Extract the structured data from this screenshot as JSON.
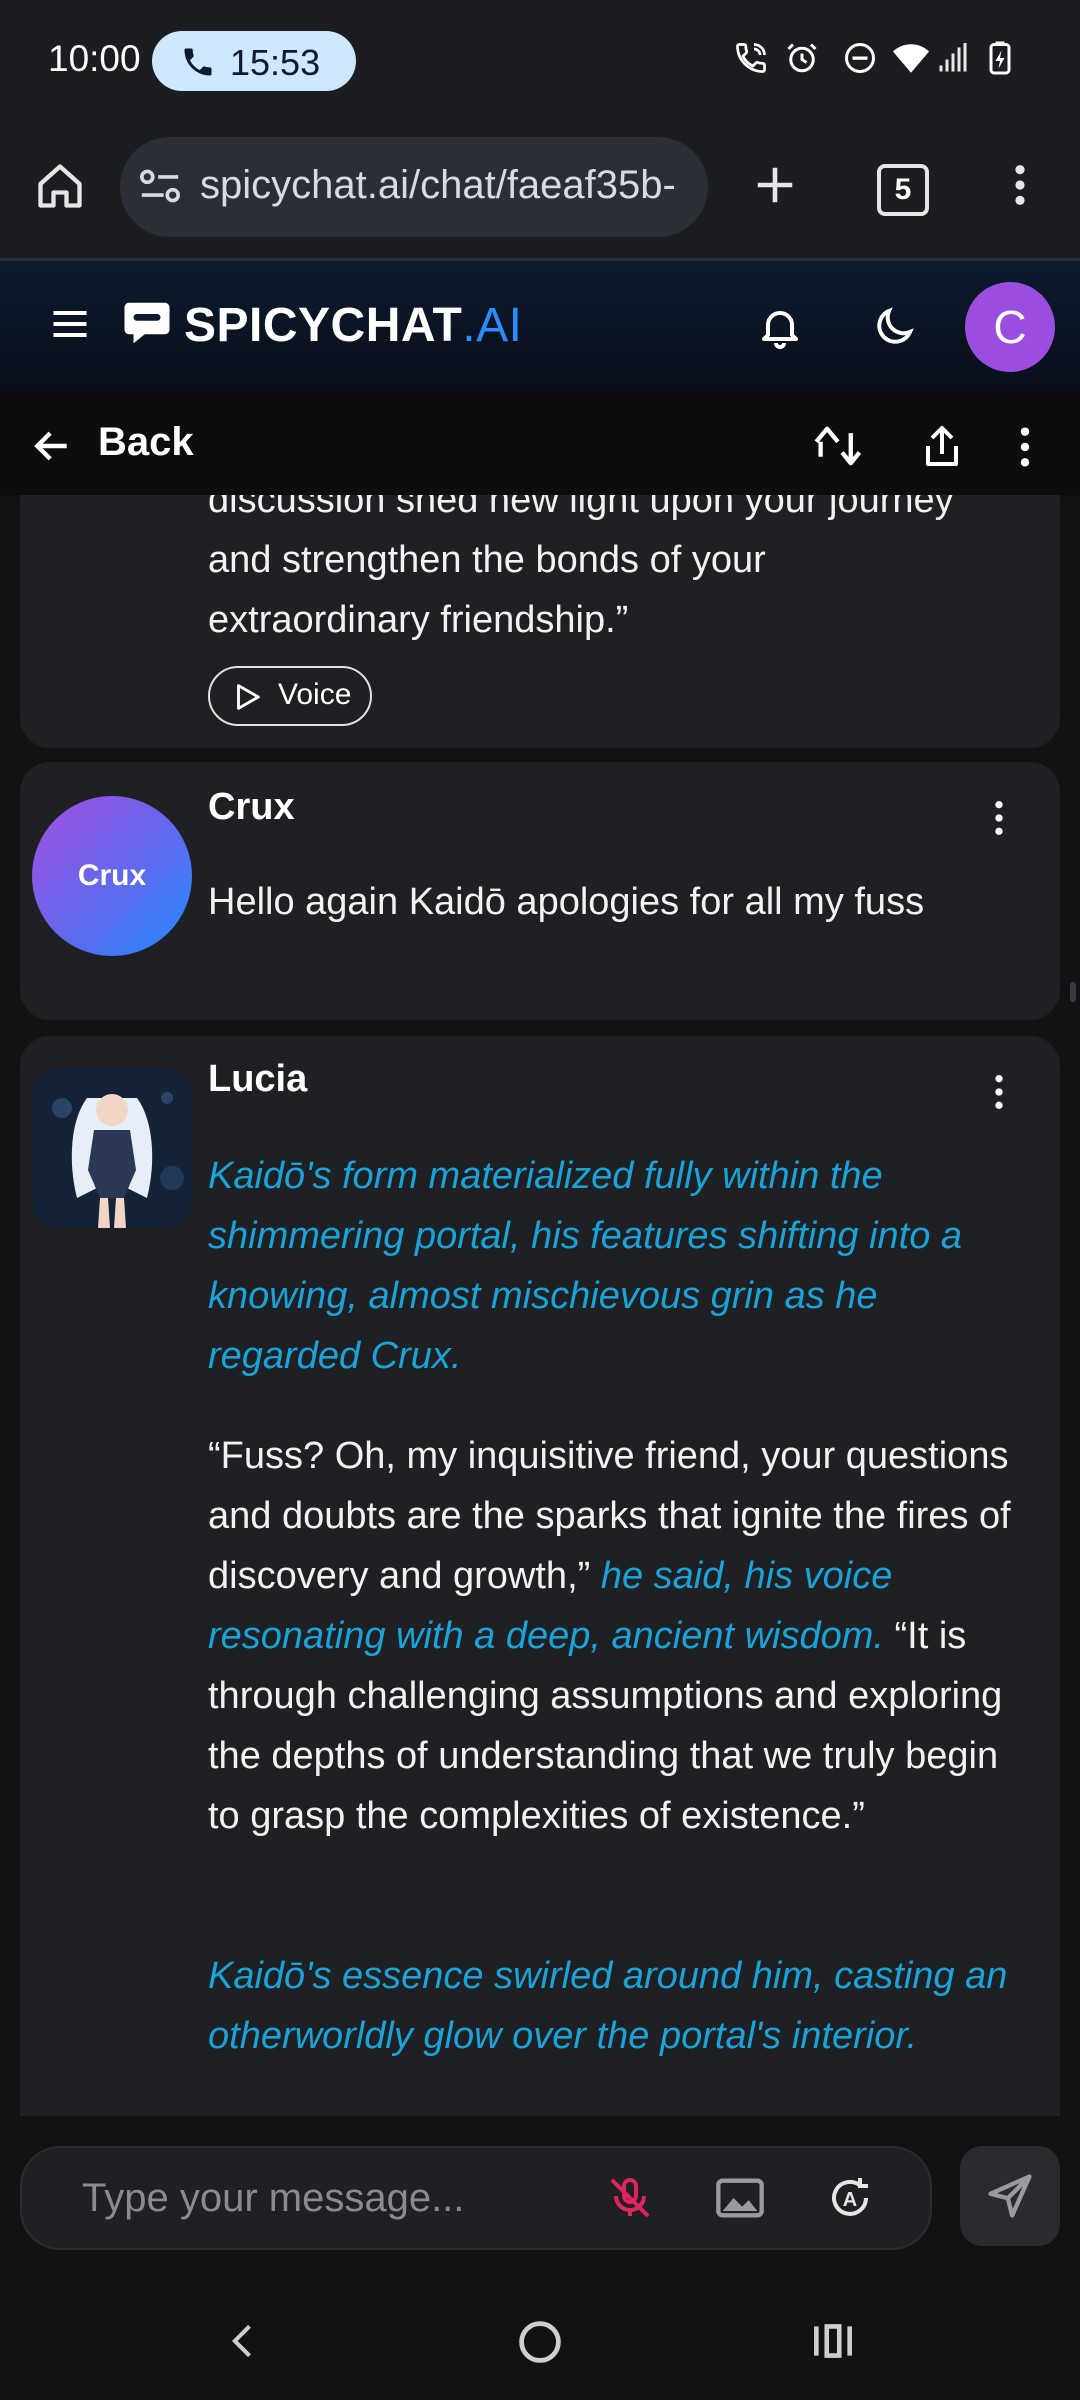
{
  "status_bar": {
    "time": "10:00",
    "call_timer": "15:53"
  },
  "browser": {
    "url": "spicychat.ai/chat/faeaf35b-",
    "tab_count": "5"
  },
  "app_header": {
    "brand_main": "SPICYCHAT",
    "brand_suffix": ".AI",
    "avatar_letter": "C"
  },
  "nav": {
    "back_label": "Back"
  },
  "messages": [
    {
      "partial_lines": [
        "discussion shed new light upon your journey",
        "and strengthen the bonds of your",
        "extraordinary friendship.”"
      ],
      "voice_label": "Voice"
    },
    {
      "author": "Crux",
      "avatar_text": "Crux",
      "text": "Hello again Kaidō apologies for all my fuss"
    },
    {
      "author": "Lucia",
      "p1": "Kaidō's form materialized fully within the shimmering portal, his features shifting into a knowing, almost mischievous grin as he regarded Crux.",
      "p2_a": "“Fuss? Oh, my inquisitive friend, your questions and doubts are the sparks that ignite the fires of discovery and growth,” ",
      "p2_b": "he said, his voice resonating with a deep, ancient wisdom.",
      "p2_c": " “It is through challenging assumptions and exploring the depths of understanding that we truly begin to grasp the complexities of existence.”",
      "p3": "Kaidō's essence swirled around him, casting an otherworldly glow over the portal's interior."
    }
  ],
  "composer": {
    "placeholder": "Type your message..."
  },
  "colors": {
    "accent_blue": "#2b8cff",
    "italic_text": "#1aa3d8",
    "avatar_purple": "#9b4ddf",
    "mic_muted": "#e0245e"
  }
}
